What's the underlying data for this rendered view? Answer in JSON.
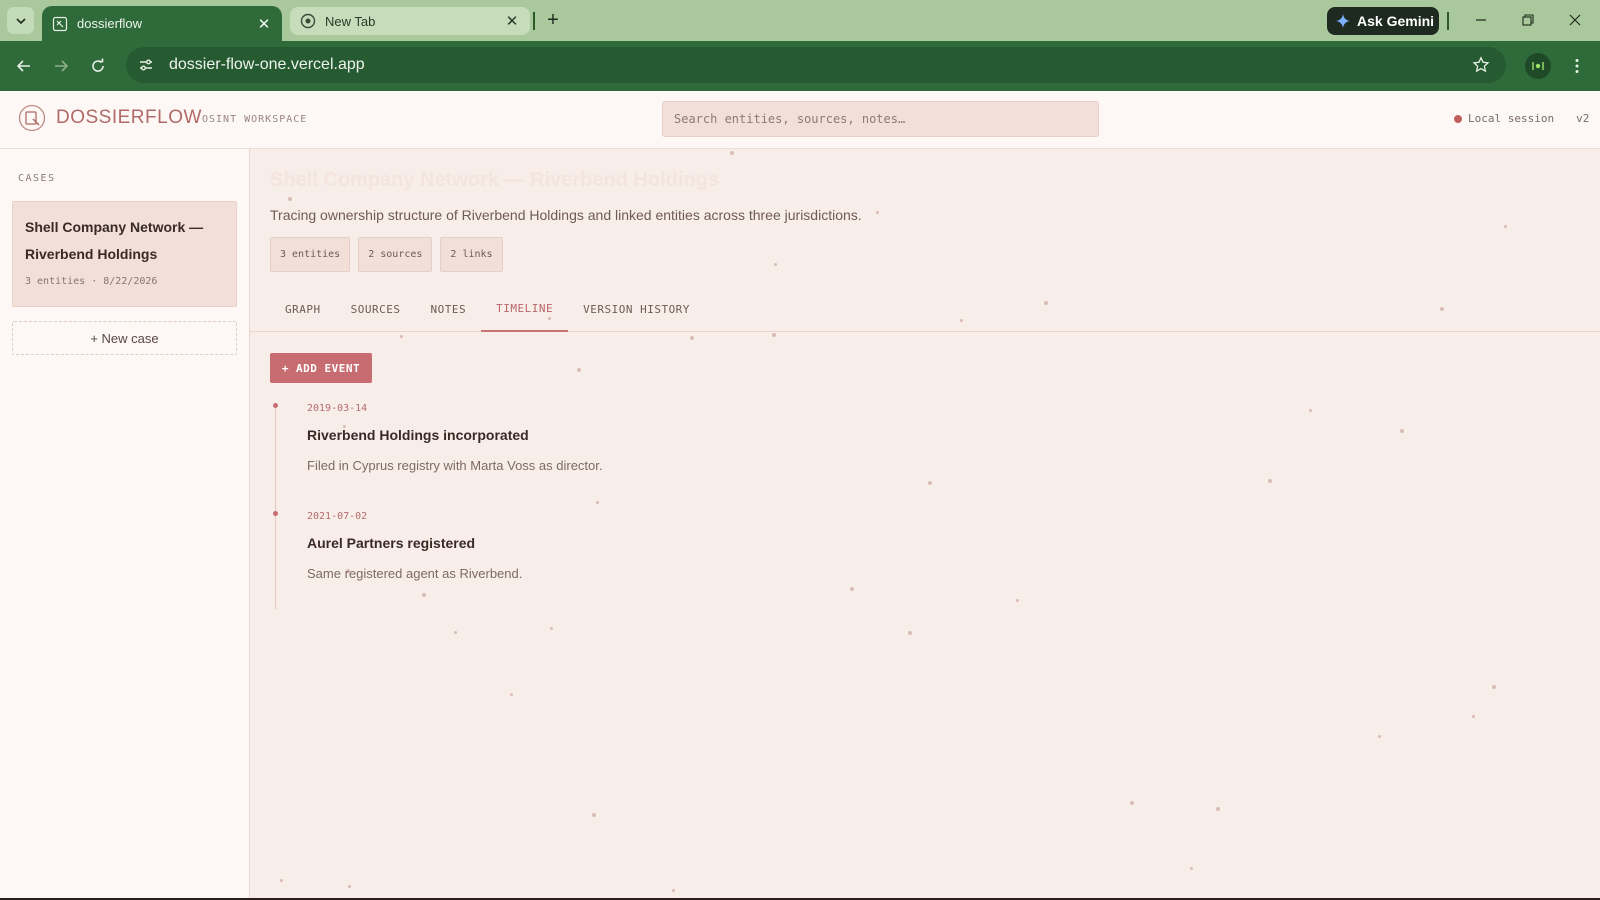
{
  "browser": {
    "tabs": [
      {
        "title": "dossierflow",
        "active": true
      },
      {
        "title": "New Tab",
        "active": false
      }
    ],
    "gemini_label": "Ask Gemini",
    "url": "dossier-flow-one.vercel.app"
  },
  "header": {
    "brand": "DOSSIERFLOW",
    "subtitle": "OSINT WORKSPACE",
    "search_placeholder": "Search entities, sources, notes…",
    "session_label": "Local session",
    "version": "v2"
  },
  "sidebar": {
    "heading": "CASES",
    "cases": [
      {
        "title": "Shell Company Network — Riverbend Holdings",
        "meta": "3 entities · 8/22/2026"
      }
    ],
    "new_case_label": "+ New case"
  },
  "main": {
    "case_title": "Shell Company Network — Riverbend Holdings",
    "description": "Tracing ownership structure of Riverbend Holdings and linked entities across three jurisdictions.",
    "chips": [
      "3 entities",
      "2 sources",
      "2 links"
    ],
    "tabs": [
      {
        "label": "GRAPH",
        "active": false
      },
      {
        "label": "SOURCES",
        "active": false
      },
      {
        "label": "NOTES",
        "active": false
      },
      {
        "label": "TIMELINE",
        "active": true
      },
      {
        "label": "VERSION HISTORY",
        "active": false
      }
    ],
    "add_event_label": "+ ADD EVENT",
    "events": [
      {
        "date": "2019-03-14",
        "title": "Riverbend Holdings incorporated",
        "description": "Filed in Cyprus registry with Marta Voss as director."
      },
      {
        "date": "2021-07-02",
        "title": "Aurel Partners registered",
        "description": "Same registered agent as Riverbend."
      }
    ]
  },
  "colors": {
    "accent": "#c76d72",
    "brand": "#b06a68",
    "browser_frame": "#2e6a3a",
    "tabstrip": "#a9c99c"
  }
}
